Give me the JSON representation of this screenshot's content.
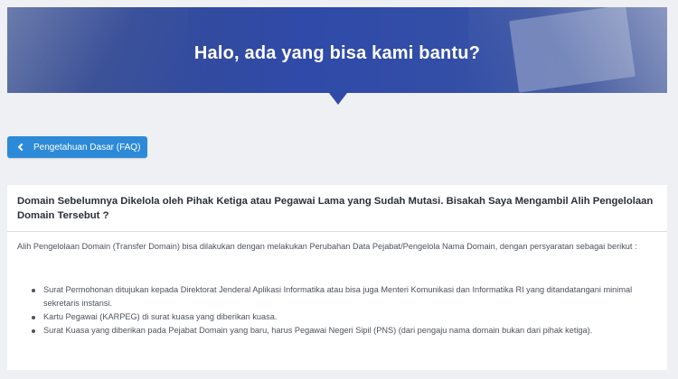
{
  "hero": {
    "title": "Halo, ada yang bisa kami bantu?"
  },
  "back_button": {
    "label": "Pengetahuan Dasar (FAQ)"
  },
  "article": {
    "question": "Domain Sebelumnya Dikelola oleh Pihak Ketiga atau Pegawai Lama yang Sudah Mutasi. Bisakah Saya Mengambil Alih Pengelolaan Domain Tersebut ?",
    "intro": "Alih Pengelolaan Domain (Transfer Domain) bisa dilakukan dengan melakukan Perubahan Data Pejabat/Pengelola Nama Domain, dengan persyaratan sebagai berikut :",
    "requirements": [
      "Surat Permohonan ditujukan kepada Direktorat Jenderal Aplikasi Informatika atau bisa juga Menteri Komunikasi dan Informatika RI yang ditandatangani minimal sekretaris instansi.",
      "Kartu Pegawai (KARPEG) di surat kuasa yang diberikan kuasa.",
      "Surat Kuasa yang diberikan pada Pejabat Domain yang baru, harus Pegawai Negeri Sipil (PNS) (dari pengaju nama domain bukan dari pihak ketiga)."
    ]
  },
  "colors": {
    "page_background": "#eef0f3",
    "hero_blue": "#2f4aa8",
    "button_blue": "#2d8ad8"
  }
}
